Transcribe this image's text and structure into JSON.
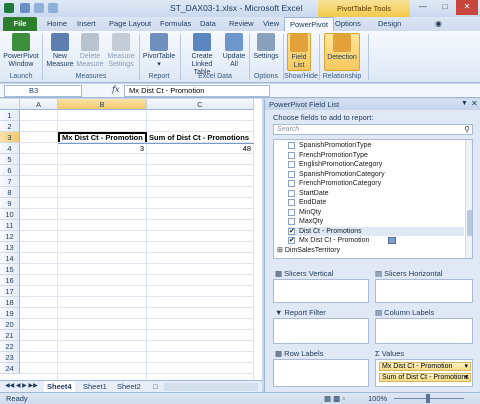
{
  "window": {
    "title": "ST_DAX03-1.xlsx - Microsoft Excel",
    "context_tab_group": "PivotTable Tools"
  },
  "tabs": [
    "File",
    "Home",
    "Insert",
    "Page Layout",
    "Formulas",
    "Data",
    "Review",
    "View",
    "PowerPivot",
    "Options",
    "Design"
  ],
  "ribbon": {
    "buttons": {
      "powerpivot_window": "PowerPivot Window",
      "new_measure": "New Measure",
      "delete_measure": "Delete Measure",
      "measure_settings": "Measure Settings",
      "pivottable": "PivotTable",
      "create_linked_table": "Create Linked Table",
      "update_all": "Update All",
      "settings": "Settings",
      "field_list": "Field List",
      "detection": "Detection"
    },
    "groups": {
      "launch": "Launch",
      "measures": "Measures",
      "report": "Report",
      "excel_data": "Excel Data",
      "options": "Options",
      "show_hide": "Show/Hide",
      "relationship": "Relationship"
    }
  },
  "formula_bar": {
    "name_box": "B3",
    "fx": "fx",
    "value": "Mx Dist Ct - Promotion"
  },
  "sheet": {
    "columns": [
      "A",
      "B",
      "C"
    ],
    "rows": [
      "1",
      "2",
      "3",
      "4",
      "5",
      "6",
      "7",
      "8",
      "9",
      "10",
      "11",
      "12",
      "13",
      "14",
      "15",
      "16",
      "17",
      "18",
      "19",
      "20",
      "21",
      "22",
      "23",
      "24"
    ],
    "b3": "Mx Dist Ct - Promotion",
    "c3": "Sum of Dist Ct - Promotions",
    "b4": "3",
    "c4": "48"
  },
  "sheet_tabs": [
    "Sheet4",
    "Sheet1",
    "Sheet2"
  ],
  "status": {
    "ready": "Ready",
    "zoom": "100%"
  },
  "pane": {
    "title": "PowerPivot Field List",
    "choose_label": "Choose fields to add to report:",
    "search_placeholder": "Search",
    "fields": [
      {
        "label": "SpanishPromotionType",
        "checked": false
      },
      {
        "label": "FrenchPromotionType",
        "checked": false
      },
      {
        "label": "EnglishPromotionCategory",
        "checked": false
      },
      {
        "label": "SpanishPromotionCategory",
        "checked": false
      },
      {
        "label": "FrenchPromotionCategory",
        "checked": false
      },
      {
        "label": "StartDate",
        "checked": false
      },
      {
        "label": "EndDate",
        "checked": false
      },
      {
        "label": "MinQty",
        "checked": false
      },
      {
        "label": "MaxQty",
        "checked": false
      },
      {
        "label": "Dist Ct - Promotions",
        "checked": true
      },
      {
        "label": "Mx Dist Ct - Promotion",
        "checked": true
      }
    ],
    "table_node": "DimSalesTerritory",
    "areas": {
      "slicers_vertical": "Slicers Vertical",
      "slicers_horizontal": "Slicers Horizontal",
      "report_filter": "Report Filter",
      "column_labels": "Column Labels",
      "row_labels": "Row Labels",
      "values": "Values"
    },
    "values_items": [
      "Mx Dist Ct - Promotion",
      "Sum of Dist Ct - Promotions"
    ]
  }
}
